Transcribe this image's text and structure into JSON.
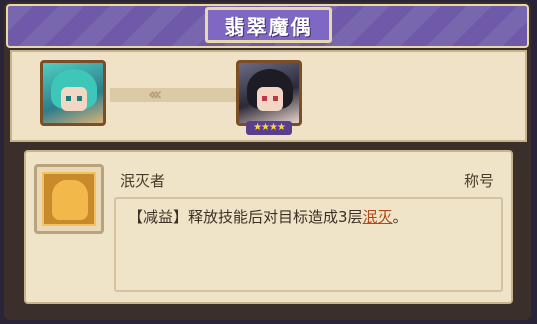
{
  "header": {
    "title": "翡翠魔偶"
  },
  "evolution": {
    "from_portrait": "teal-haired-character-portrait",
    "to_portrait": "black-haired-character-portrait",
    "arrow_glyph": "‹‹‹",
    "to_stars": "★★★★"
  },
  "skill": {
    "icon": "golden-creature-skill-icon",
    "name": "泯灭者",
    "tag": "称号",
    "desc_prefix": "【减益】释放技能后对目标造成3层",
    "desc_keyword": "泯灭",
    "desc_suffix": "。"
  },
  "colors": {
    "header_purple": "#6e5aa8",
    "panel_cream": "#f0e4c8",
    "keyword": "#b04a1c",
    "star": "#ffd24a"
  }
}
